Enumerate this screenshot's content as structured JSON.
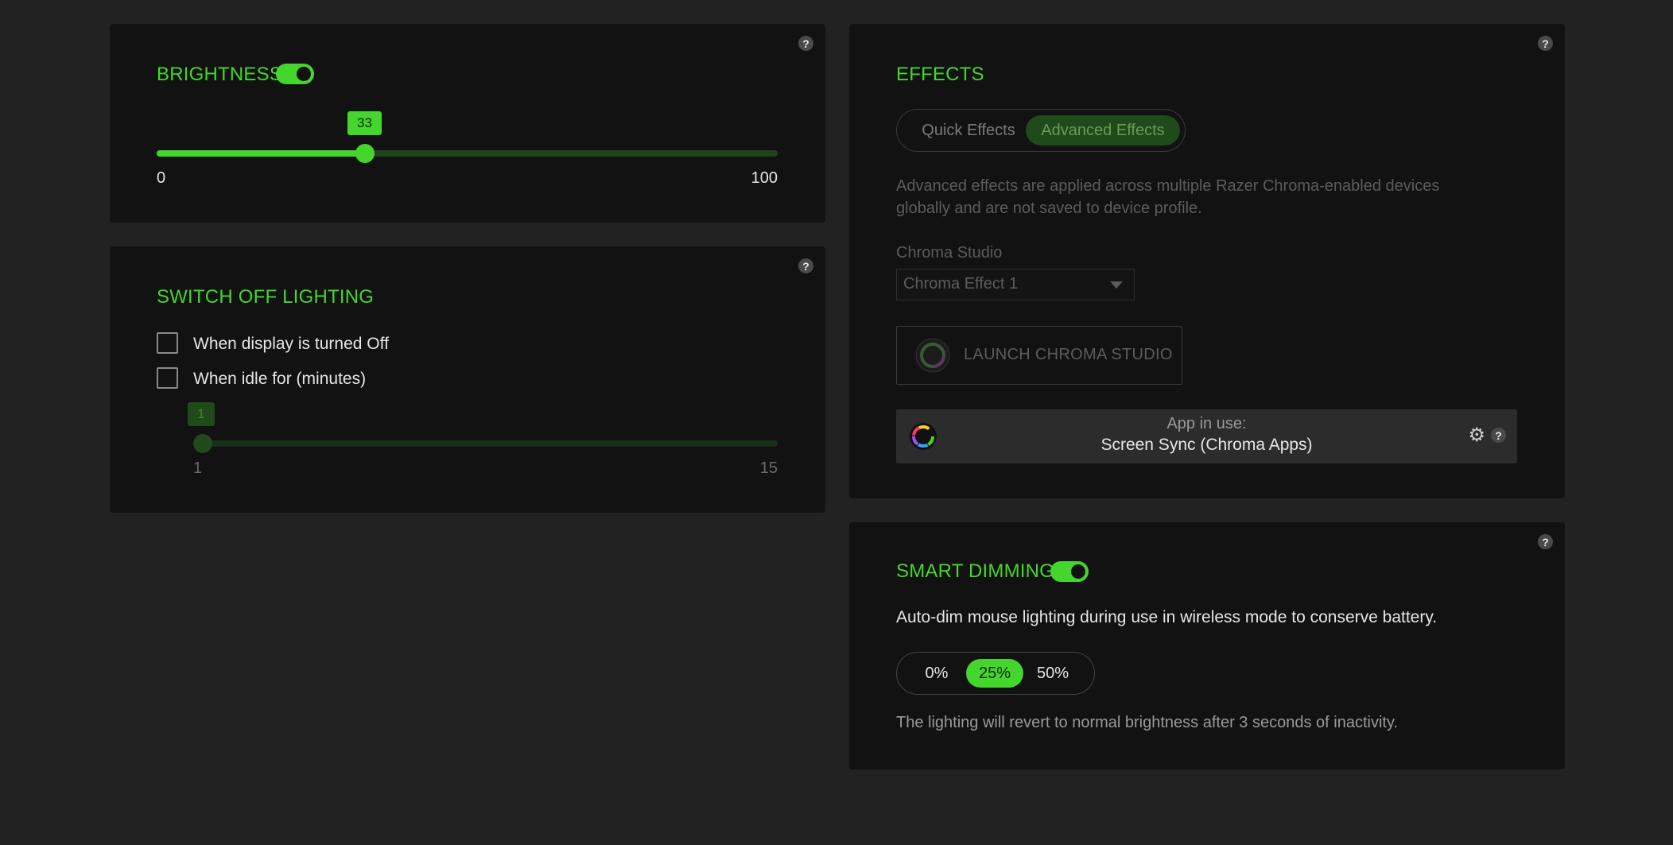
{
  "brightness": {
    "title": "BRIGHTNESS",
    "toggle_on": true,
    "value": "33",
    "value_fraction": 0.33,
    "min_label": "0",
    "max_label": "100",
    "help": "?"
  },
  "switch_off": {
    "title": "SWITCH OFF LIGHTING",
    "help": "?",
    "options": [
      {
        "label": "When display is turned Off",
        "checked": false
      },
      {
        "label": "When idle for (minutes)",
        "checked": false
      }
    ],
    "idle_value": "1",
    "min_label": "1",
    "max_label": "15"
  },
  "effects": {
    "title": "EFFECTS",
    "help": "?",
    "tabs": [
      "Quick Effects",
      "Advanced Effects"
    ],
    "active_tab": "Advanced Effects",
    "description_line1": "Advanced effects are applied across multiple Razer Chroma-enabled devices",
    "description_line2": "globally and are not saved to device profile.",
    "studio_label": "Chroma Studio",
    "studio_selected": "Chroma Effect 1",
    "launch_button": "LAUNCH CHROMA STUDIO",
    "app_in_use_label": "App in use:",
    "app_in_use_value": "Screen Sync (Chroma Apps)",
    "app_help": "?"
  },
  "smart_dimming": {
    "title": "SMART DIMMING",
    "help": "?",
    "toggle_on": true,
    "description": "Auto-dim mouse lighting during use in wireless mode to conserve battery.",
    "options": [
      "0%",
      "25%",
      "50%"
    ],
    "selected": "25%",
    "note": "The lighting will revert to normal brightness after 3 seconds of inactivity."
  },
  "colors": {
    "accent": "#44d62c",
    "card_bg": "#121212",
    "page_bg": "#222222",
    "dim_green": "#1f4a1a"
  },
  "icons": [
    "help-icon",
    "chroma-ring-icon",
    "gear-icon",
    "chevron-down-icon"
  ]
}
